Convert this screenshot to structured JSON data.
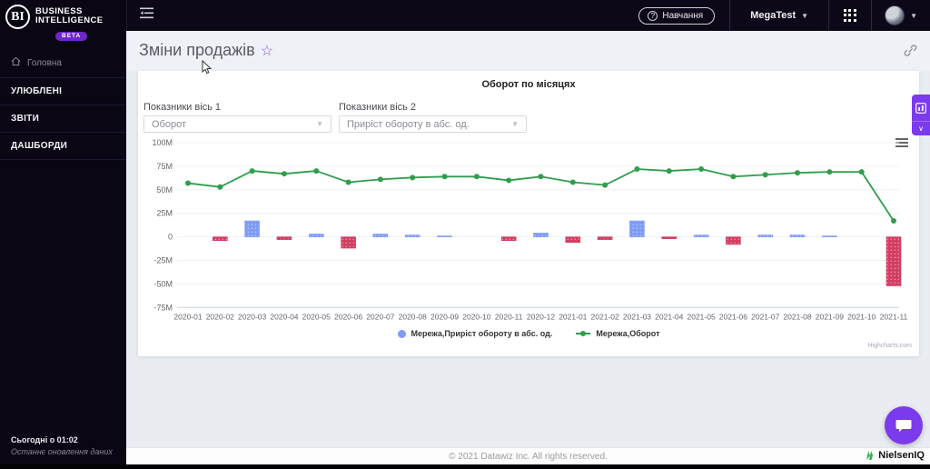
{
  "topbar": {
    "training": "Навчання",
    "workspace": "MegaTest"
  },
  "sidebar": {
    "brand_mark": "BI",
    "brand_line1": "BUSINESS",
    "brand_line2": "INTELLIGENCE",
    "brand_badge": "BETA",
    "home": "Головна",
    "sections": [
      {
        "label": "УЛЮБЛЕНІ"
      },
      {
        "label": "ЗВІТИ"
      },
      {
        "label": "ДАШБОРДИ"
      }
    ],
    "updated_time": "Сьогодні о 01:02",
    "updated_caption": "Останнє оновлення даних"
  },
  "main": {
    "title": "Зміни продажів",
    "panel": {
      "title": "Оборот по місяцях",
      "axis1_label": "Показники вісь 1",
      "axis1_value": "Оборот",
      "axis2_label": "Показники вісь 2",
      "axis2_value": "Приріст обороту в абс. од.",
      "credits": "Highcharts.com"
    }
  },
  "chart_data": {
    "type": "bar+line combo",
    "categories": [
      "2020-01",
      "2020-02",
      "2020-03",
      "2020-04",
      "2020-05",
      "2020-06",
      "2020-07",
      "2020-08",
      "2020-09",
      "2020-10",
      "2020-11",
      "2020-12",
      "2021-01",
      "2021-02",
      "2021-03",
      "2021-04",
      "2021-05",
      "2021-06",
      "2021-07",
      "2021-08",
      "2021-09",
      "2021-10",
      "2021-11"
    ],
    "series": [
      {
        "name": "Мережа,Приріст обороту в абс. од.",
        "type": "bar",
        "unit": "M",
        "values": [
          null,
          -4,
          17,
          -3,
          3,
          -12,
          3,
          2,
          1,
          0,
          -4,
          4,
          -6,
          -3,
          17,
          -2,
          2,
          -8,
          2,
          2,
          1,
          0,
          -52
        ]
      },
      {
        "name": "Мережа,Оборот",
        "type": "line",
        "unit": "M",
        "values": [
          57,
          53,
          70,
          67,
          70,
          58,
          61,
          63,
          64,
          64,
          60,
          64,
          58,
          55,
          72,
          70,
          72,
          64,
          66,
          68,
          69,
          69,
          17
        ]
      }
    ],
    "ylim": [
      -75,
      100
    ],
    "yticks": [
      {
        "v": 100,
        "label": "100M"
      },
      {
        "v": 75,
        "label": "75M"
      },
      {
        "v": 50,
        "label": "50M"
      },
      {
        "v": 25,
        "label": "25M"
      },
      {
        "v": 0,
        "label": "0"
      },
      {
        "v": -25,
        "label": "-25M"
      },
      {
        "v": -50,
        "label": "-50M"
      },
      {
        "v": -75,
        "label": "-75M"
      }
    ],
    "grid": true,
    "legend_position": "bottom-center",
    "colors": {
      "bar_positive": "#7f9cf5",
      "bar_negative": "#d23f62",
      "line": "#2f9e4c"
    }
  },
  "footer": {
    "copyright": "© 2021 Datawiz Inc. All rights reserved.",
    "brand": "NielsenIQ"
  },
  "colors": {
    "accent": "#7c3aed",
    "topbar_bg": "#0d0818",
    "sidebar_bg": "#0a0614"
  }
}
